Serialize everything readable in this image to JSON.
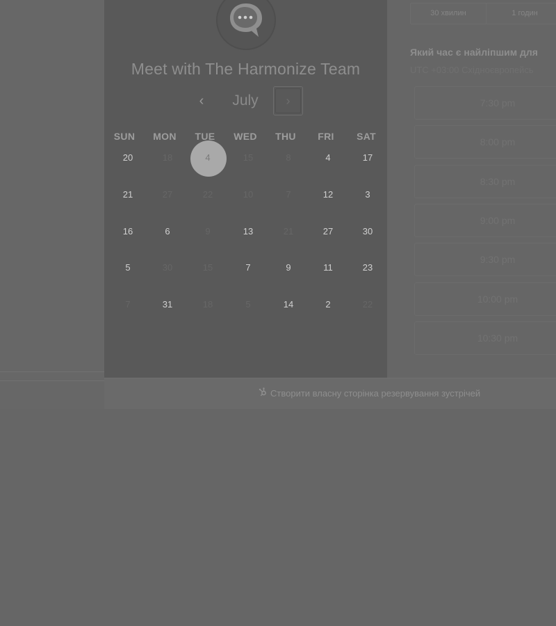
{
  "meeting": {
    "title": "Meet with The Harmonize Team"
  },
  "calendar": {
    "month": "July",
    "prev_icon": "‹",
    "next_icon": "›",
    "weekdays": [
      "SUN",
      "MON",
      "TUE",
      "WED",
      "THU",
      "FRI",
      "SAT"
    ],
    "weeks": [
      [
        {
          "d": "20",
          "s": "on"
        },
        {
          "d": "18",
          "s": "off"
        },
        {
          "d": "4",
          "s": "sel"
        },
        {
          "d": "15",
          "s": "off"
        },
        {
          "d": "8",
          "s": "off"
        },
        {
          "d": "4",
          "s": "on"
        },
        {
          "d": "17",
          "s": "on"
        }
      ],
      [
        {
          "d": "21",
          "s": "on"
        },
        {
          "d": "27",
          "s": "off"
        },
        {
          "d": "22",
          "s": "off"
        },
        {
          "d": "10",
          "s": "off"
        },
        {
          "d": "7",
          "s": "off"
        },
        {
          "d": "12",
          "s": "on"
        },
        {
          "d": "3",
          "s": "on"
        }
      ],
      [
        {
          "d": "16",
          "s": "on"
        },
        {
          "d": "6",
          "s": "on"
        },
        {
          "d": "9",
          "s": "off"
        },
        {
          "d": "13",
          "s": "on"
        },
        {
          "d": "21",
          "s": "off"
        },
        {
          "d": "27",
          "s": "on"
        },
        {
          "d": "30",
          "s": "on"
        }
      ],
      [
        {
          "d": "5",
          "s": "on"
        },
        {
          "d": "30",
          "s": "off"
        },
        {
          "d": "15",
          "s": "off"
        },
        {
          "d": "7",
          "s": "on"
        },
        {
          "d": "9",
          "s": "on"
        },
        {
          "d": "11",
          "s": "on"
        },
        {
          "d": "23",
          "s": "on"
        }
      ],
      [
        {
          "d": "7",
          "s": "off"
        },
        {
          "d": "31",
          "s": "on"
        },
        {
          "d": "18",
          "s": "off"
        },
        {
          "d": "5",
          "s": "off"
        },
        {
          "d": "14",
          "s": "on"
        },
        {
          "d": "2",
          "s": "on"
        },
        {
          "d": "22",
          "s": "off"
        }
      ]
    ]
  },
  "duration": {
    "options": [
      "30 хвилин",
      "1 годин"
    ]
  },
  "schedule": {
    "question": "Який час є найліпшим для",
    "timezone": "UTC +03:00 Східноєвропейсь",
    "slots": [
      "7:30 pm",
      "8:00 pm",
      "8:30 pm",
      "9:00 pm",
      "9:30 pm",
      "10:00 pm",
      "10:30 pm"
    ]
  },
  "footer": {
    "link": "Створити власну сторінка резервування зустрічей"
  },
  "colors": {
    "overlay": "#666666",
    "panel": "#595959",
    "selected_day": "#a9a9a9"
  },
  "icons": {
    "avatar": "chat-bubble-icon",
    "footer": "sprocket-icon"
  }
}
